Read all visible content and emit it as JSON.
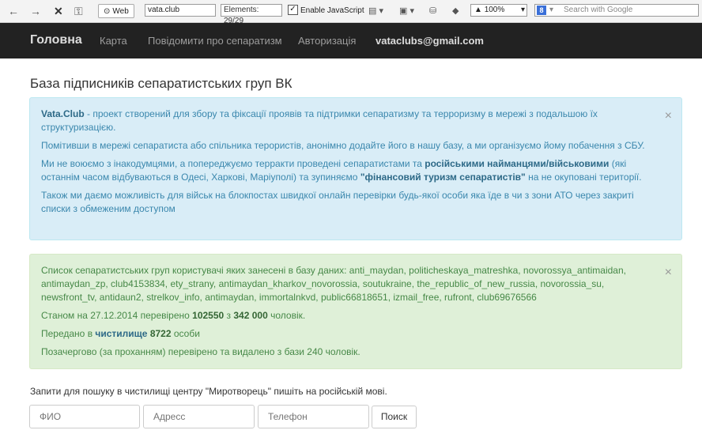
{
  "browser": {
    "web_label": "Web",
    "url": "vata.club",
    "elements_text": "Elements:  29/29",
    "enable_js_label": "Enable JavaScript",
    "zoom_value": "100%",
    "search_placeholder": "Search with Google",
    "search_badge": "8"
  },
  "nav": {
    "brand": "Головна",
    "items": [
      "Карта",
      "Повідомити про сепаратизм",
      "Авторизація"
    ],
    "email": "vataclubs@gmail.com"
  },
  "page_title": "База підписників сепаратистських груп ВК",
  "info": {
    "p1_brand": "Vata.Club",
    "p1_rest": " - проект створений для збору та фіксації проявів та підтримки сепаратизму та терроризму в мережі з подальшою їх структуризацією.",
    "p2": "Помітивши в мережі сепаратиста або спільника терористів, анонімно додайте його в нашу базу, а ми організуємо йому побачення з СБУ.",
    "p3_a": "Ми не воюємо з інакодумцями, а попереджуємо терракти проведені сепаратистами та ",
    "p3_b1": "російськими найманцями/військовими",
    "p3_c": " (які останнім часом відбуваються в Одесі, Харкові, Маріуполі) та зупиняємо ",
    "p3_b2": "\"фінансовий туризм сепаратистів\"",
    "p3_d": " на не окуповані території.",
    "p4": "Також ми даємо можливість для військ на блокпостах швидкої онлайн перевірки будь-якої особи яка їде в чи з зони АТО через закриті списки з обмеженим доступом"
  },
  "success": {
    "groups": "Список сепаратистських груп користувачі яких занесені в базу даних: anti_maydan, politicheskaya_matreshka, novorossya_antimaidan, antimaydan_zp, club4153834, ety_strany, antimaydan_kharkov_novorossia, soutukraine, the_republic_of_new_russia, novorossia_su, newsfront_tv, antidaun2, strelkov_info, antimaydan, immortalnkvd, public66818651, izmail_free, rufront, club69676566",
    "status_a": "Станом на 27.12.2014 перевірено ",
    "status_n1": "102550",
    "status_b": " з ",
    "status_n2": "342 000",
    "status_c": " чоловік.",
    "transfer_a": "Передано в ",
    "transfer_link": "чистилище",
    "transfer_n": "8722",
    "transfer_b": " особи",
    "deleted": "Позачергово (за проханням) перевірено та видалено з бази 240 чоловік."
  },
  "query_hint": "Запити для пошуку в чистилищі центру \"Миротворець\" пишіть на російській мові.",
  "form": {
    "fio_placeholder": "ФИО",
    "address_placeholder": "Адресс",
    "phone_placeholder": "Телефон",
    "search_button": "Поиск"
  }
}
